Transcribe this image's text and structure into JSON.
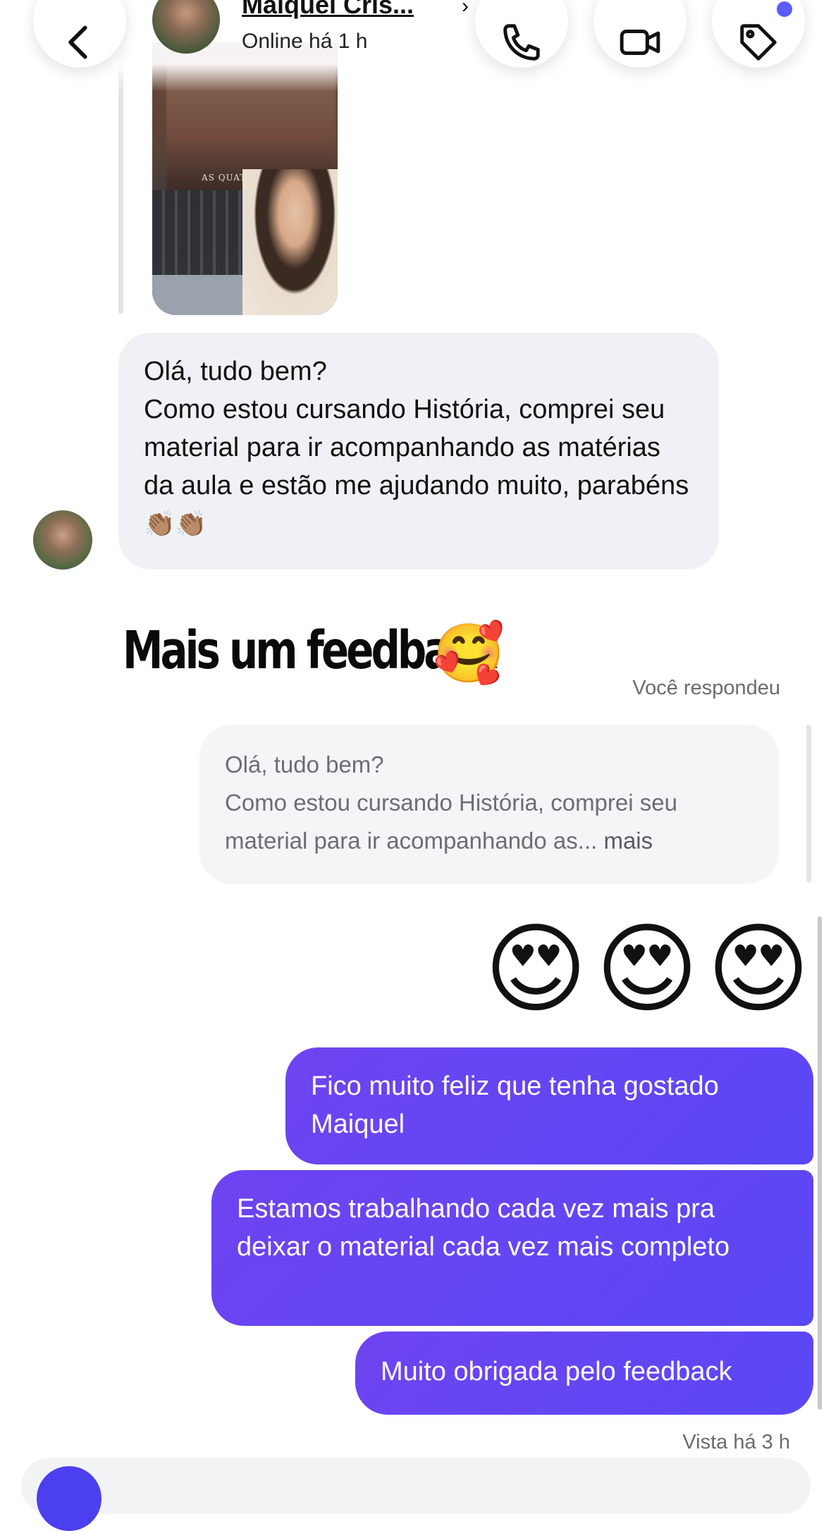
{
  "header": {
    "contact_name": "Maiquel Cris...",
    "status": "Online há 1 h",
    "chevron": "›",
    "icons": [
      "back-icon",
      "phone-icon",
      "video-camera-icon",
      "tag-icon"
    ]
  },
  "thread": {
    "story_title": "AS QUATRO GRANDES",
    "incoming_message": {
      "line1": "Olá, tudo bem?",
      "line2": "Como estou cursando História, comprei seu material para ir acompanhando as matérias da aula e estão me ajudando muito, parabéns",
      "emoji": "👏🏽👏🏽"
    },
    "overlay_caption": "Mais um feedback",
    "overlay_emoji": "🥰",
    "replied_label": "Você respondeu",
    "quoted": {
      "line1": "Olá, tudo bem?",
      "line2": "Como estou cursando História, comprei seu material para ir acompanhando as...",
      "more": "mais"
    },
    "reaction_emojis": [
      "😍",
      "😍",
      "😍"
    ],
    "outgoing": [
      "Fico muito feliz que tenha gostado Maiquel",
      "Estamos trabalhando cada vez mais pra deixar o material cada vez mais completo",
      "Muito obrigada pelo feedback"
    ],
    "seen_label": "Vista há 3 h"
  },
  "colors": {
    "outgoing_bubble": "#5f46f2",
    "incoming_bubble": "#eff1f4",
    "notification_dot": "#5b5bff"
  }
}
